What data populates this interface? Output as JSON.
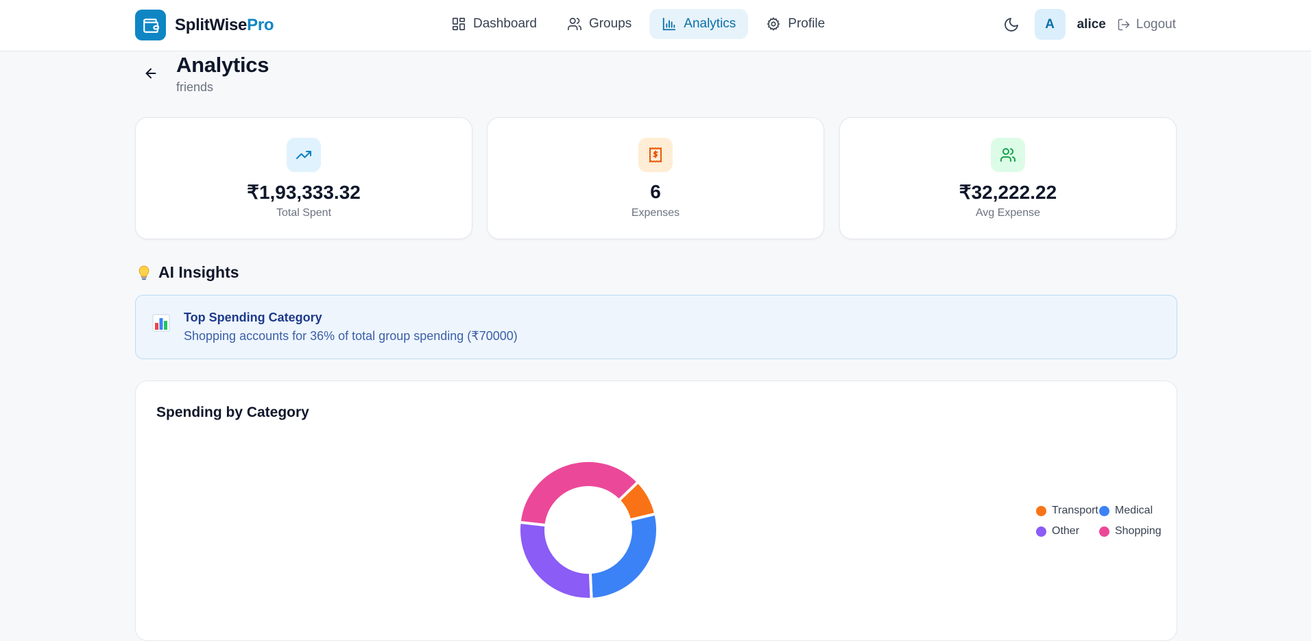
{
  "brand": {
    "name": "SplitWise",
    "accent": "Pro",
    "logo_icon": "wallet-icon",
    "color": "#0e86c4"
  },
  "nav": {
    "items": [
      {
        "label": "Dashboard",
        "icon": "dashboard-grid-icon",
        "active": false
      },
      {
        "label": "Groups",
        "icon": "users-icon",
        "active": false
      },
      {
        "label": "Analytics",
        "icon": "bar-chart-icon",
        "active": true
      },
      {
        "label": "Profile",
        "icon": "gear-icon",
        "active": false
      }
    ],
    "theme_toggle_icon": "moon-icon",
    "avatar_initial": "A",
    "username": "alice",
    "logout_label": "Logout"
  },
  "page": {
    "title": "Analytics",
    "subtitle": "friends"
  },
  "stats": [
    {
      "value": "₹1,93,333.32",
      "label": "Total Spent",
      "icon": "trending-up-icon",
      "bg": "#e0f2fe",
      "color": "#0b7fc2"
    },
    {
      "value": "6",
      "label": "Expenses",
      "icon": "receipt-icon",
      "bg": "#ffedd5",
      "color": "#ea580c"
    },
    {
      "value": "₹32,222.22",
      "label": "Avg Expense",
      "icon": "users-icon",
      "bg": "#dcfce7",
      "color": "#16a34a"
    }
  ],
  "insights": {
    "heading": "AI Insights",
    "heading_icon": "lightbulb-icon",
    "items": [
      {
        "icon": "bar-chart-emoji-icon",
        "title": "Top Spending Category",
        "text": "Shopping accounts for 36% of total group spending (₹70000)"
      }
    ]
  },
  "chart_data": {
    "type": "pie",
    "title": "Spending by Category",
    "categories": [
      "Transport",
      "Medical",
      "Other",
      "Shopping"
    ],
    "values": [
      8.5,
      28,
      27.5,
      36
    ],
    "colors": [
      "#f97316",
      "#3b82f6",
      "#8b5cf6",
      "#ec4899"
    ],
    "donut": true,
    "legend": "right"
  }
}
